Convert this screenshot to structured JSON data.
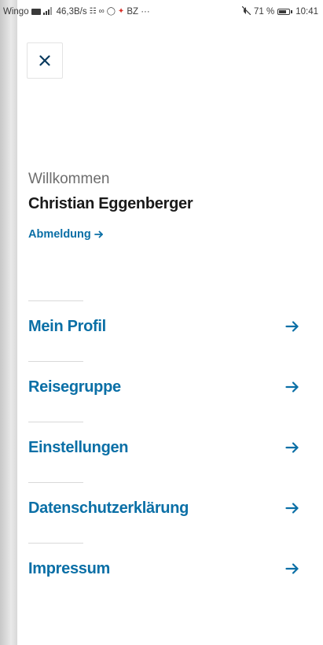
{
  "status_bar": {
    "carrier": "Wingo",
    "network_speed": "46,3B/s",
    "extra": "BZ ···",
    "battery_text": "71 %",
    "battery_level": 0.71,
    "time": "10:41"
  },
  "close_button": {
    "icon": "close-icon"
  },
  "greeting": {
    "welcome": "Willkommen",
    "user_name": "Christian Eggenberger",
    "logout_label": "Abmeldung"
  },
  "menu": {
    "items": [
      {
        "label": "Mein Profil"
      },
      {
        "label": "Reisegruppe"
      },
      {
        "label": "Einstellungen"
      },
      {
        "label": "Datenschutzerklärung"
      },
      {
        "label": "Impressum"
      }
    ]
  },
  "colors": {
    "accent": "#0a6fa6",
    "text_primary": "#1a1a1a",
    "text_secondary": "#6d6d6d",
    "divider": "#d9d9d9"
  }
}
